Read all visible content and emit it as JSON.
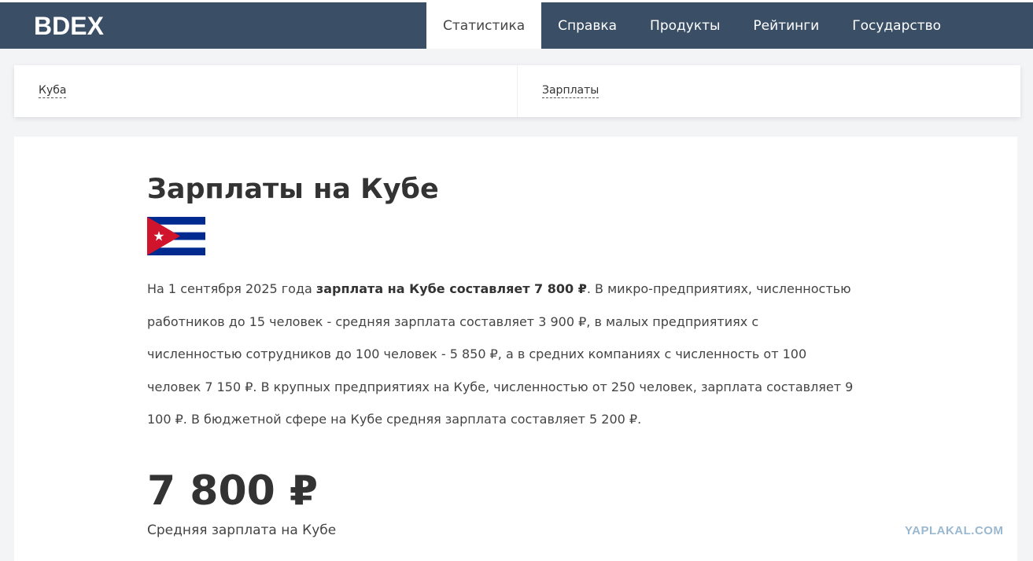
{
  "header": {
    "logo": "BDEX",
    "nav": [
      {
        "label": "Статистика",
        "active": true
      },
      {
        "label": "Справка"
      },
      {
        "label": "Продукты"
      },
      {
        "label": "Рейтинги"
      },
      {
        "label": "Государство"
      }
    ]
  },
  "breadcrumbs": [
    "Куба",
    "Зарплаты"
  ],
  "main": {
    "title": "Зарплаты на Кубе",
    "flag": "cuba-flag",
    "paragraph": {
      "pre": "На 1 сентября 2025 года ",
      "bold": "зарплата на Кубе составляет 7 800 ₽",
      "post": ". В микро-предприятиях, численностью работников до 15 человек - средняя зарплата составляет 3 900 ₽, в малых предприятиях с численностью сотрудников до 100 человек - 5 850 ₽, а в средних компаниях с численность от 100 человек 7 150 ₽. В крупных предприятиях на Кубе, численностью от 250 человек, зарплата составляет 9 100 ₽. В бюджетной сфере на Кубе средняя зарплата составляет 5 200 ₽."
    },
    "big_value": "7 800 ₽",
    "big_caption": "Средняя зарплата на Кубе"
  },
  "watermark": "YAPLAKAL.COM"
}
